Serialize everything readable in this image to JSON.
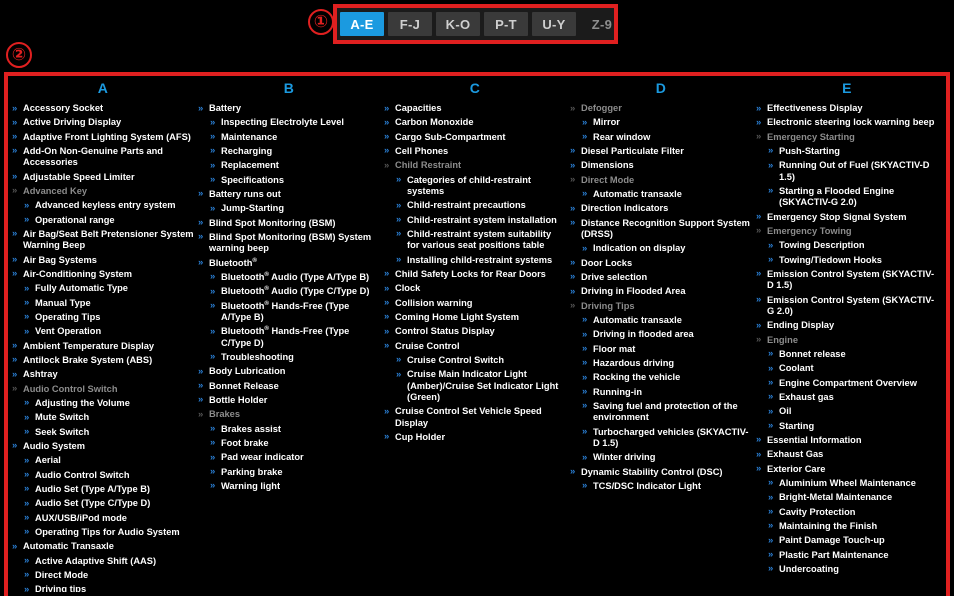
{
  "markers": {
    "one": "①",
    "two": "②"
  },
  "icons": {
    "bullet": "»"
  },
  "colors": {
    "accent_blue": "#1b9ae0",
    "bullet_blue": "#2a7fd4",
    "annotation_red": "#e02020",
    "background": "#000000",
    "dim_gray": "#8c8c8c",
    "tab_inactive": "#3a3a3a"
  },
  "tabbar": {
    "name": "alphabet-range-tabs",
    "tabs": [
      {
        "label": "A-E",
        "state": "active"
      },
      {
        "label": "F-J",
        "state": "inactive"
      },
      {
        "label": "K-O",
        "state": "inactive"
      },
      {
        "label": "P-T",
        "state": "inactive"
      },
      {
        "label": "U-Y",
        "state": "inactive"
      },
      {
        "label": "Z-9",
        "state": "disabled"
      }
    ]
  },
  "columns": [
    {
      "heading": "A",
      "entries": [
        {
          "label": "Accessory Socket",
          "type": "link"
        },
        {
          "label": "Active Driving Display",
          "type": "link"
        },
        {
          "label": "Adaptive Front Lighting System (AFS)",
          "type": "link"
        },
        {
          "label": "Add-On Non-Genuine Parts and Accessories",
          "type": "link"
        },
        {
          "label": "Adjustable Speed Limiter",
          "type": "link"
        },
        {
          "label": "Advanced Key",
          "type": "plain",
          "children": [
            {
              "label": "Advanced keyless entry system",
              "type": "link"
            },
            {
              "label": "Operational range",
              "type": "link"
            }
          ]
        },
        {
          "label": "Air Bag/Seat Belt Pretensioner System Warning Beep",
          "type": "link"
        },
        {
          "label": "Air Bag Systems",
          "type": "link"
        },
        {
          "label": "Air-Conditioning System",
          "type": "link",
          "children": [
            {
              "label": "Fully Automatic Type",
              "type": "link"
            },
            {
              "label": "Manual Type",
              "type": "link"
            },
            {
              "label": "Operating Tips",
              "type": "link"
            },
            {
              "label": "Vent Operation",
              "type": "link"
            }
          ]
        },
        {
          "label": "Ambient Temperature Display",
          "type": "link"
        },
        {
          "label": "Antilock Brake System (ABS)",
          "type": "link"
        },
        {
          "label": "Ashtray",
          "type": "link"
        },
        {
          "label": "Audio Control Switch",
          "type": "plain",
          "children": [
            {
              "label": "Adjusting the Volume",
              "type": "link"
            },
            {
              "label": "Mute Switch",
              "type": "link"
            },
            {
              "label": "Seek Switch",
              "type": "link"
            }
          ]
        },
        {
          "label": "Audio System",
          "type": "link",
          "children": [
            {
              "label": "Aerial",
              "type": "link"
            },
            {
              "label": "Audio Control Switch",
              "type": "link"
            },
            {
              "label": "Audio Set (Type A/Type B)",
              "type": "link"
            },
            {
              "label": "Audio Set (Type C/Type D)",
              "type": "link"
            },
            {
              "label": "AUX/USB/iPod mode",
              "type": "link"
            },
            {
              "label": "Operating Tips for Audio System",
              "type": "link"
            }
          ]
        },
        {
          "label": "Automatic Transaxle",
          "type": "link",
          "children": [
            {
              "label": "Active Adaptive Shift (AAS)",
              "type": "link"
            },
            {
              "label": "Direct Mode",
              "type": "link"
            },
            {
              "label": "Driving tips",
              "type": "link"
            }
          ]
        }
      ]
    },
    {
      "heading": "B",
      "entries": [
        {
          "label": "Battery",
          "type": "link",
          "children": [
            {
              "label": "Inspecting Electrolyte Level",
              "type": "link"
            },
            {
              "label": "Maintenance",
              "type": "link"
            },
            {
              "label": "Recharging",
              "type": "link"
            },
            {
              "label": "Replacement",
              "type": "link"
            },
            {
              "label": "Specifications",
              "type": "link"
            }
          ]
        },
        {
          "label": "Battery runs out",
          "type": "link",
          "children": [
            {
              "label": "Jump-Starting",
              "type": "link"
            }
          ]
        },
        {
          "label": "Blind Spot Monitoring (BSM)",
          "type": "link"
        },
        {
          "label": "Blind Spot Monitoring (BSM) System warning beep",
          "type": "link"
        },
        {
          "label": "Bluetooth®",
          "type": "link",
          "children": [
            {
              "label": "Bluetooth® Audio (Type A/Type B)",
              "type": "link"
            },
            {
              "label": "Bluetooth® Audio (Type C/Type D)",
              "type": "link"
            },
            {
              "label": "Bluetooth® Hands-Free (Type A/Type B)",
              "type": "link"
            },
            {
              "label": "Bluetooth® Hands-Free (Type C/Type D)",
              "type": "link"
            },
            {
              "label": "Troubleshooting",
              "type": "link"
            }
          ]
        },
        {
          "label": "Body Lubrication",
          "type": "link"
        },
        {
          "label": "Bonnet Release",
          "type": "link"
        },
        {
          "label": "Bottle Holder",
          "type": "link"
        },
        {
          "label": "Brakes",
          "type": "plain",
          "children": [
            {
              "label": "Brakes assist",
              "type": "link"
            },
            {
              "label": "Foot brake",
              "type": "link"
            },
            {
              "label": "Pad wear indicator",
              "type": "link"
            },
            {
              "label": "Parking brake",
              "type": "link"
            },
            {
              "label": "Warning light",
              "type": "link"
            }
          ]
        }
      ]
    },
    {
      "heading": "C",
      "entries": [
        {
          "label": "Capacities",
          "type": "link"
        },
        {
          "label": "Carbon Monoxide",
          "type": "link"
        },
        {
          "label": "Cargo Sub-Compartment",
          "type": "link"
        },
        {
          "label": "Cell Phones",
          "type": "link"
        },
        {
          "label": "Child Restraint",
          "type": "plain",
          "children": [
            {
              "label": "Categories of child-restraint systems",
              "type": "link"
            },
            {
              "label": "Child-restraint precautions",
              "type": "link"
            },
            {
              "label": "Child-restraint system installation",
              "type": "link"
            },
            {
              "label": "Child-restraint system suitability for various seat positions table",
              "type": "link"
            },
            {
              "label": "Installing child-restraint systems",
              "type": "link"
            }
          ]
        },
        {
          "label": "Child Safety Locks for Rear Doors",
          "type": "link"
        },
        {
          "label": "Clock",
          "type": "link"
        },
        {
          "label": "Collision warning",
          "type": "link"
        },
        {
          "label": "Coming Home Light System",
          "type": "link"
        },
        {
          "label": "Control Status Display",
          "type": "link"
        },
        {
          "label": "Cruise Control",
          "type": "link",
          "children": [
            {
              "label": "Cruise Control Switch",
              "type": "link"
            },
            {
              "label": "Cruise Main Indicator Light (Amber)/Cruise Set Indicator Light (Green)",
              "type": "link"
            }
          ]
        },
        {
          "label": "Cruise Control Set Vehicle Speed Display",
          "type": "link"
        },
        {
          "label": "Cup Holder",
          "type": "link"
        }
      ]
    },
    {
      "heading": "D",
      "entries": [
        {
          "label": "Defogger",
          "type": "plain",
          "children": [
            {
              "label": "Mirror",
              "type": "link"
            },
            {
              "label": "Rear window",
              "type": "link"
            }
          ]
        },
        {
          "label": "Diesel Particulate Filter",
          "type": "link"
        },
        {
          "label": "Dimensions",
          "type": "link"
        },
        {
          "label": "Direct Mode",
          "type": "plain",
          "children": [
            {
              "label": "Automatic transaxle",
              "type": "link"
            }
          ]
        },
        {
          "label": "Direction Indicators",
          "type": "link"
        },
        {
          "label": "Distance Recognition Support System (DRSS)",
          "type": "link",
          "children": [
            {
              "label": "Indication on display",
              "type": "link"
            }
          ]
        },
        {
          "label": "Door Locks",
          "type": "link"
        },
        {
          "label": "Drive selection",
          "type": "link"
        },
        {
          "label": "Driving in Flooded Area",
          "type": "link"
        },
        {
          "label": "Driving Tips",
          "type": "plain",
          "children": [
            {
              "label": "Automatic transaxle",
              "type": "link"
            },
            {
              "label": "Driving in flooded area",
              "type": "link"
            },
            {
              "label": "Floor mat",
              "type": "link"
            },
            {
              "label": "Hazardous driving",
              "type": "link"
            },
            {
              "label": "Rocking the vehicle",
              "type": "link"
            },
            {
              "label": "Running-in",
              "type": "link"
            },
            {
              "label": "Saving fuel and protection of the environment",
              "type": "link"
            },
            {
              "label": "Turbocharged vehicles (SKYACTIV-D 1.5)",
              "type": "link"
            },
            {
              "label": "Winter driving",
              "type": "link"
            }
          ]
        },
        {
          "label": "Dynamic Stability Control (DSC)",
          "type": "link",
          "children": [
            {
              "label": "TCS/DSC Indicator Light",
              "type": "link"
            }
          ]
        }
      ]
    },
    {
      "heading": "E",
      "entries": [
        {
          "label": "Effectiveness Display",
          "type": "link"
        },
        {
          "label": "Electronic steering lock warning beep",
          "type": "link"
        },
        {
          "label": "Emergency Starting",
          "type": "plain",
          "children": [
            {
              "label": "Push-Starting",
              "type": "link"
            },
            {
              "label": "Running Out of Fuel (SKYACTIV-D 1.5)",
              "type": "link"
            },
            {
              "label": "Starting a Flooded Engine (SKYACTIV-G 2.0)",
              "type": "link"
            }
          ]
        },
        {
          "label": "Emergency Stop Signal System",
          "type": "link"
        },
        {
          "label": "Emergency Towing",
          "type": "plain",
          "children": [
            {
              "label": "Towing Description",
              "type": "link"
            },
            {
              "label": "Towing/Tiedown Hooks",
              "type": "link"
            }
          ]
        },
        {
          "label": "Emission Control System (SKYACTIV-D 1.5)",
          "type": "link"
        },
        {
          "label": "Emission Control System (SKYACTIV-G 2.0)",
          "type": "link"
        },
        {
          "label": "Ending Display",
          "type": "link"
        },
        {
          "label": "Engine",
          "type": "plain",
          "children": [
            {
              "label": "Bonnet release",
              "type": "link"
            },
            {
              "label": "Coolant",
              "type": "link"
            },
            {
              "label": "Engine Compartment Overview",
              "type": "link"
            },
            {
              "label": "Exhaust gas",
              "type": "link"
            },
            {
              "label": "Oil",
              "type": "link"
            },
            {
              "label": "Starting",
              "type": "link"
            }
          ]
        },
        {
          "label": "Essential Information",
          "type": "link"
        },
        {
          "label": "Exhaust Gas",
          "type": "link"
        },
        {
          "label": "Exterior Care",
          "type": "link",
          "children": [
            {
              "label": "Aluminium Wheel Maintenance",
              "type": "link"
            },
            {
              "label": "Bright-Metal Maintenance",
              "type": "link"
            },
            {
              "label": "Cavity Protection",
              "type": "link"
            },
            {
              "label": "Maintaining the Finish",
              "type": "link"
            },
            {
              "label": "Paint Damage Touch-up",
              "type": "link"
            },
            {
              "label": "Plastic Part Maintenance",
              "type": "link"
            },
            {
              "label": "Undercoating",
              "type": "link"
            }
          ]
        }
      ]
    }
  ]
}
